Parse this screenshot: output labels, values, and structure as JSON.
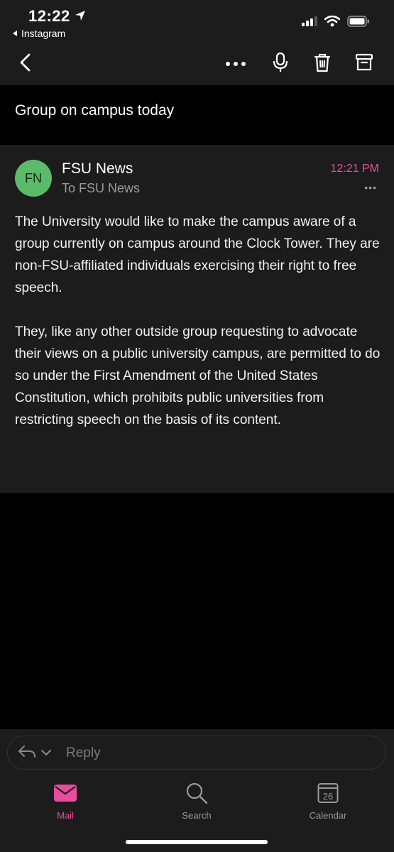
{
  "status_bar": {
    "time": "12:22",
    "back_app_label": "Instagram"
  },
  "toolbar": {
    "back_icon": "chevron-left-icon",
    "actions": [
      "more-icon",
      "microphone-icon",
      "trash-icon",
      "archive-icon"
    ]
  },
  "email": {
    "subject": "Group on campus today",
    "sender_initials": "FN",
    "sender_name": "FSU News",
    "recipient": "To FSU News",
    "time": "12:21 PM",
    "paragraphs": [
      "The University would like to make the campus aware of a group currently on campus around the Clock Tower. They are non-FSU-affiliated individuals exercising their right to free speech.",
      "They, like any other outside group requesting to advocate their views on a public university campus, are permitted to do so under the First Amendment of the United States Constitution, which prohibits public universities from restricting speech on the basis of its content."
    ]
  },
  "reply": {
    "label": "Reply"
  },
  "tabs": [
    {
      "label": "Mail",
      "active": true
    },
    {
      "label": "Search",
      "active": false
    },
    {
      "label": "Calendar",
      "active": false,
      "day": "26"
    }
  ],
  "colors": {
    "accent": "#e94c9f",
    "avatar": "#5cba6b",
    "surface": "#1c1c1c",
    "background": "#000000"
  }
}
